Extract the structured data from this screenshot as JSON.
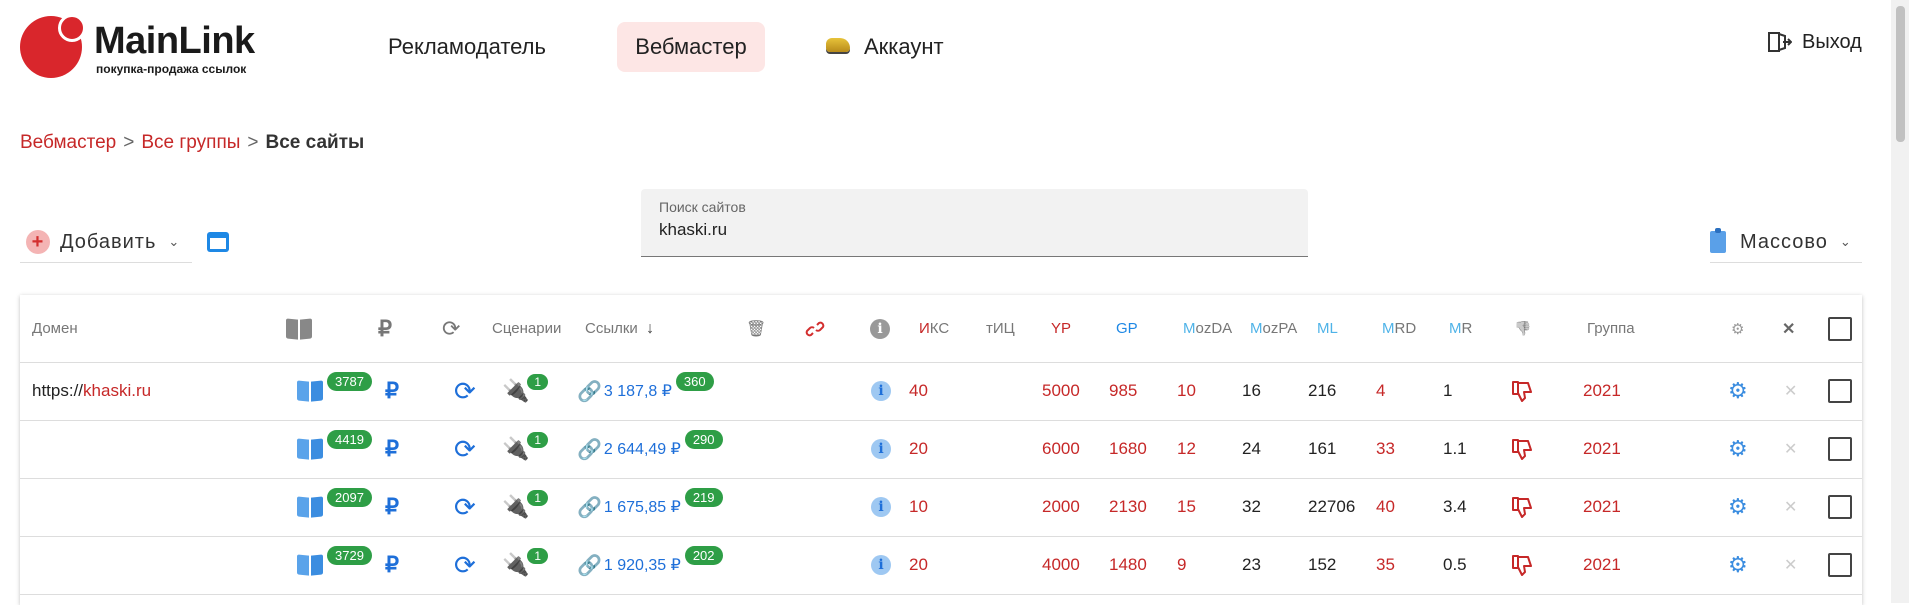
{
  "brand": {
    "name": "MainLink",
    "tagline": "покупка-продажа ссылок"
  },
  "nav": {
    "advertiser": "Рекламодатель",
    "webmaster": "Вебмастер",
    "account": "Аккаунт",
    "exit": "Выход"
  },
  "breadcrumb": {
    "item1": "Вебмастер",
    "item2": "Все группы",
    "current": "Все сайты",
    "sep": ">"
  },
  "toolbar": {
    "add_label": "Добавить",
    "mass_label": "Массово"
  },
  "search": {
    "label": "Поиск сайтов",
    "value": "khaski.ru"
  },
  "columns": {
    "domain": "Домен",
    "scenarios": "Сценарии",
    "links": "Ссылки",
    "iks_first": "И",
    "iks_rest": "КС",
    "tic": "тИЦ",
    "yr": "YP",
    "gp": "GP",
    "mozda_prefix": "M",
    "mozda_rest": "ozDA",
    "mozpa_prefix": "M",
    "mozpa_rest": "ozPA",
    "ml": "ML",
    "mrd_prefix": "M",
    "mrd_rest": "RD",
    "mr_prefix": "M",
    "mr_rest": "R",
    "group": "Группа",
    "sort_arrow": "↓"
  },
  "rows": [
    {
      "domain_prefix": "https://",
      "domain_name": "khaski.ru",
      "pages": "3787",
      "scen_count": "1",
      "links_sum": "3 187,8 ₽",
      "links_count": "360",
      "iks": "40",
      "tic": "",
      "yr": "5000",
      "gp": "985",
      "mozda": "10",
      "mozpa": "16",
      "ml": "216",
      "mrd": "4",
      "mr": "1",
      "group": "2021"
    },
    {
      "domain_prefix": "",
      "domain_name": "",
      "pages": "4419",
      "scen_count": "1",
      "links_sum": "2 644,49 ₽",
      "links_count": "290",
      "iks": "20",
      "tic": "",
      "yr": "6000",
      "gp": "1680",
      "mozda": "12",
      "mozpa": "24",
      "ml": "161",
      "mrd": "33",
      "mr": "1.1",
      "group": "2021"
    },
    {
      "domain_prefix": "",
      "domain_name": "",
      "pages": "2097",
      "scen_count": "1",
      "links_sum": "1 675,85 ₽",
      "links_count": "219",
      "iks": "10",
      "tic": "",
      "yr": "2000",
      "gp": "2130",
      "mozda": "15",
      "mozpa": "32",
      "ml": "22706",
      "mrd": "40",
      "mr": "3.4",
      "group": "2021"
    },
    {
      "domain_prefix": "",
      "domain_name": "",
      "pages": "3729",
      "scen_count": "1",
      "links_sum": "1 920,35 ₽",
      "links_count": "202",
      "iks": "20",
      "tic": "",
      "yr": "4000",
      "gp": "1480",
      "mozda": "9",
      "mozpa": "23",
      "ml": "152",
      "mrd": "35",
      "mr": "0.5",
      "group": "2021"
    }
  ],
  "icons": {
    "ruble": "₽",
    "info": "i",
    "gear": "⚙",
    "close": "✕",
    "sync": "⟳",
    "thumb_down": "👎"
  },
  "colors": {
    "accent_red": "#c62828",
    "link_blue": "#1e6fd9",
    "badge_green": "#2e9e46",
    "nav_active_bg": "#fde6e5"
  }
}
